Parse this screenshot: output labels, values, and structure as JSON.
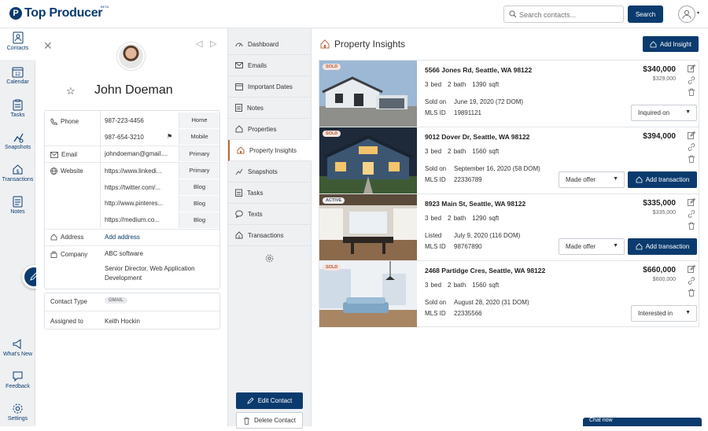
{
  "header": {
    "brand": "Top Producer",
    "beta": "BETA",
    "search_placeholder": "Search contacts...",
    "search_button": "Search"
  },
  "nav": {
    "items": [
      {
        "label": "Contacts",
        "icon": "contacts-icon"
      },
      {
        "label": "Calendar",
        "icon": "calendar-icon"
      },
      {
        "label": "Tasks",
        "icon": "tasks-icon"
      },
      {
        "label": "Snapshots",
        "icon": "snapshots-icon"
      },
      {
        "label": "Transactions",
        "icon": "transactions-icon"
      },
      {
        "label": "Notes",
        "icon": "notes-icon"
      }
    ],
    "calendar_day": "12",
    "bottom": [
      {
        "label": "What's New"
      },
      {
        "label": "Feedback"
      },
      {
        "label": "Settings"
      }
    ]
  },
  "contact": {
    "name": "John Doeman",
    "phone_label": "Phone",
    "phones": [
      {
        "number": "987-223-4456",
        "type": "Home"
      },
      {
        "number": "987-654-3210",
        "type": "Mobile"
      }
    ],
    "email_label": "Email",
    "email": {
      "value": "johndoeman@gmail....",
      "type": "Primary"
    },
    "website_label": "Website",
    "websites": [
      {
        "value": "https://www.linkedi...",
        "type": "Primary"
      },
      {
        "value": "https://twitter.com/...",
        "type": "Blog"
      },
      {
        "value": "http://www.pinteres...",
        "type": "Blog"
      },
      {
        "value": "https://medium.co...",
        "type": "Blog"
      }
    ],
    "address_label": "Address",
    "address_value": "Add address",
    "company_label": "Company",
    "company_name": "ABC software",
    "company_title": "Senior Director, Web Application Development",
    "contact_type_label": "Contact Type",
    "contact_type_value": "GMAIL",
    "assigned_label": "Assigned to",
    "assigned_value": "Keith Hockin"
  },
  "menu": {
    "items": [
      {
        "label": "Dashboard"
      },
      {
        "label": "Emails"
      },
      {
        "label": "Important Dates"
      },
      {
        "label": "Notes"
      },
      {
        "label": "Properties"
      },
      {
        "label": "Property Insights"
      },
      {
        "label": "Snapshots"
      },
      {
        "label": "Tasks"
      },
      {
        "label": "Texts"
      },
      {
        "label": "Transactions"
      }
    ],
    "edit_contact": "Edit Contact",
    "delete_contact": "Delete Contact"
  },
  "main": {
    "title": "Property Insights",
    "add_insight": "Add Insight",
    "listings": [
      {
        "badge": "SOLD",
        "address": "5566 Jones Rd, Seattle, WA 98122",
        "beds": "3 bed",
        "baths": "2 bath",
        "sqft": "1390 sqft",
        "status_label": "Sold on",
        "status_value": "June 19, 2020 (72 DOM)",
        "mls_label": "MLS ID",
        "mls_value": "19891121",
        "price": "$340,000",
        "old_price": "$329,000",
        "select_value": "Inquired on",
        "action_button": null
      },
      {
        "badge": "SOLD",
        "address": "9012 Dover Dr, Seattle, WA 98122",
        "beds": "3 bed",
        "baths": "2 bath",
        "sqft": "1560 sqft",
        "status_label": "Sold on",
        "status_value": "September 16, 2020 (58 DOM)",
        "mls_label": "MLS ID",
        "mls_value": "22336789",
        "price": "$394,000",
        "old_price": "",
        "select_value": "Made offer",
        "action_button": "Add transaction"
      },
      {
        "badge": "ACTIVE",
        "address": "8923 Main St, Seattle, WA 98122",
        "beds": "3 bed",
        "baths": "2 bath",
        "sqft": "1290 sqft",
        "status_label": "Listed",
        "status_value": "July 9, 2020 (116 DOM)",
        "mls_label": "MLS ID",
        "mls_value": "98767890",
        "price": "$335,000",
        "old_price": "$335,000",
        "select_value": "Made offer",
        "action_button": "Add transaction"
      },
      {
        "badge": "SOLD",
        "address": "2468 Partidge Cres, Seattle, WA 98122",
        "beds": "3 bed",
        "baths": "2 bath",
        "sqft": "1560 sqft",
        "status_label": "Sold on",
        "status_value": "August 28, 2020 (31 DOM)",
        "mls_label": "MLS ID",
        "mls_value": "22335566",
        "price": "$660,000",
        "old_price": "$600,000",
        "select_value": "Interested in",
        "action_button": null
      }
    ]
  },
  "chat": {
    "label": "Chat now"
  },
  "colors": {
    "brand": "#0b3b6e",
    "sold_badge": "#f7e3dc",
    "accent": "#b76a3f"
  }
}
